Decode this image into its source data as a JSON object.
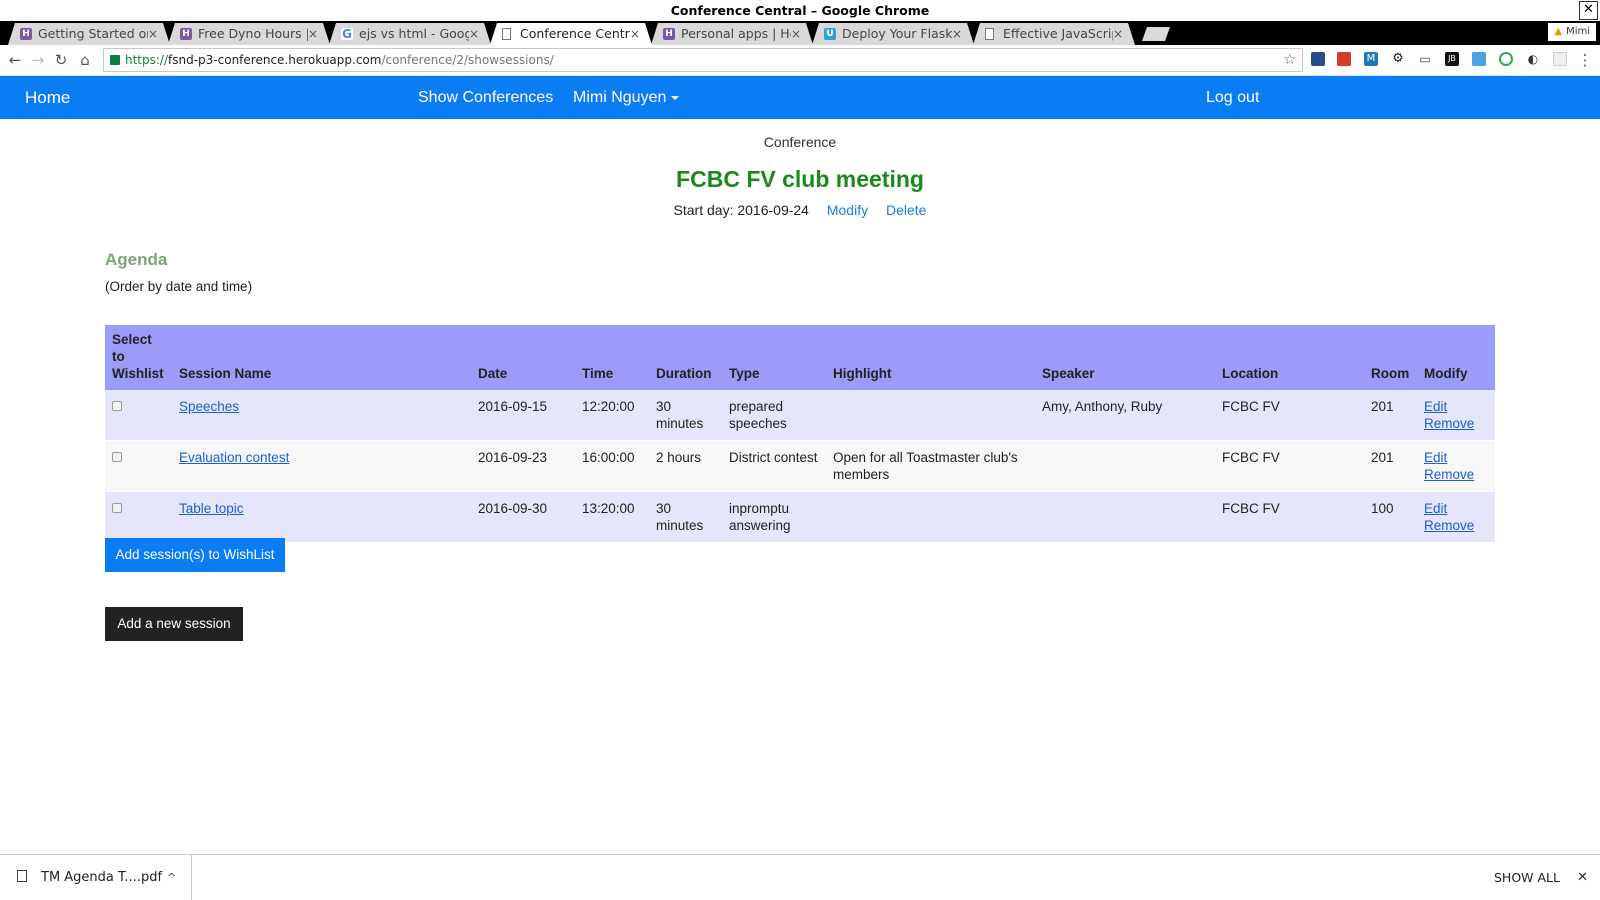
{
  "window": {
    "title": "Conference Central – Google Chrome",
    "close_glyph": "✕"
  },
  "tabs": [
    {
      "label": "Getting Started on H",
      "favicon": "H",
      "favicon_color": "#79589f"
    },
    {
      "label": "Free Dyno Hours | H",
      "favicon": "H",
      "favicon_color": "#79589f"
    },
    {
      "label": "ejs vs html - Google",
      "favicon": "G",
      "favicon_color": "#4285f4"
    },
    {
      "label": "Conference Central",
      "favicon": "doc",
      "favicon_color": "#777777"
    },
    {
      "label": "Personal apps | Her",
      "favicon": "H",
      "favicon_color": "#79589f"
    },
    {
      "label": "Deploy Your Flask A",
      "favicon": "U",
      "favicon_color": "#2fa0d8"
    },
    {
      "label": "Effective JavaScript",
      "favicon": "doc",
      "favicon_color": "#777777"
    }
  ],
  "tab_close_glyph": "×",
  "profile": {
    "name": "Mimi",
    "warning_glyph": "▲"
  },
  "toolbar": {
    "back_glyph": "←",
    "forward_glyph": "→",
    "reload_glyph": "↻",
    "home_glyph": "⌂",
    "url_scheme": "https://",
    "url_host": "fsnd-p3-conference.herokuapp.com",
    "url_path": "/conference/2/showsessions/",
    "star_glyph": "☆",
    "menu_glyph": "⋮"
  },
  "navbar": {
    "home": "Home",
    "show_conferences": "Show Conferences",
    "user": "Mimi Nguyen",
    "logout": "Log out",
    "color": "#0a7df5"
  },
  "conference": {
    "section_label": "Conference",
    "title": "FCBC FV club meeting",
    "start_day_label": "Start day: 2016-09-24",
    "modify": "Modify",
    "delete": "Delete"
  },
  "agenda": {
    "title": "Agenda",
    "subtitle": "(Order by date and time)",
    "headers": {
      "select_line1": "Select to",
      "select_line2": "Wishlist",
      "session": "Session Name",
      "date": "Date",
      "time": "Time",
      "duration": "Duration",
      "type": "Type",
      "highlight": "Highlight",
      "speaker": "Speaker",
      "location": "Location",
      "room": "Room",
      "modify": "Modify"
    },
    "rows": [
      {
        "session": "Speeches",
        "date": "2016-09-15",
        "time": "12:20:00",
        "duration": "30 minutes",
        "type": "prepared speeches",
        "highlight": "",
        "speaker": "Amy, Anthony, Ruby",
        "location": "FCBC FV",
        "room": "201",
        "edit": "Edit",
        "remove": "Remove"
      },
      {
        "session": "Evaluation contest",
        "date": "2016-09-23",
        "time": "16:00:00",
        "duration": "2 hours",
        "type": "District contest",
        "highlight": "Open for all Toastmaster club's members",
        "speaker": "",
        "location": "FCBC FV",
        "room": "201",
        "edit": "Edit",
        "remove": "Remove"
      },
      {
        "session": "Table topic",
        "date": "2016-09-30",
        "time": "13:20:00",
        "duration": "30 minutes",
        "type": "inpromptu answering",
        "highlight": "",
        "speaker": "",
        "location": "FCBC FV",
        "room": "100",
        "edit": "Edit",
        "remove": "Remove"
      }
    ]
  },
  "buttons": {
    "add_wishlist": "Add session(s) to WishList",
    "add_session": "Add a new session"
  },
  "downloads": {
    "file": "TM Agenda T....pdf",
    "chevron": "^",
    "show_all": "SHOW ALL",
    "close": "✕"
  }
}
